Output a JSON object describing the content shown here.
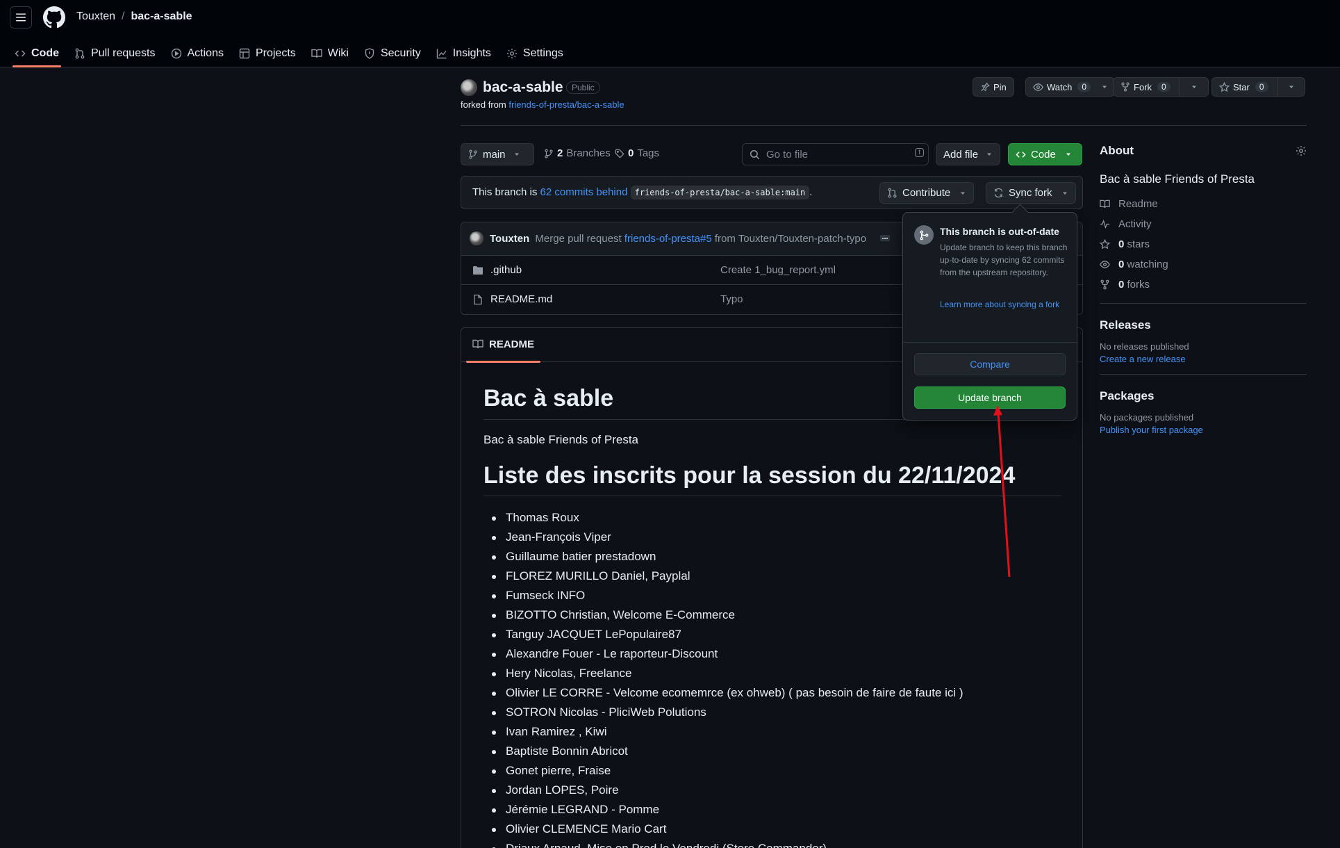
{
  "header": {
    "owner": "Touxten",
    "separator": "/",
    "repo": "bac-a-sable"
  },
  "tabs": [
    {
      "label": "Code",
      "icon": "code-icon"
    },
    {
      "label": "Pull requests",
      "icon": "pull-request-icon"
    },
    {
      "label": "Actions",
      "icon": "play-icon"
    },
    {
      "label": "Projects",
      "icon": "table-icon"
    },
    {
      "label": "Wiki",
      "icon": "book-icon"
    },
    {
      "label": "Security",
      "icon": "shield-icon"
    },
    {
      "label": "Insights",
      "icon": "graph-icon"
    },
    {
      "label": "Settings",
      "icon": "gear-icon"
    }
  ],
  "repo": {
    "name": "bac-a-sable",
    "visibility": "Public",
    "forked_prefix": "forked from",
    "forked_from": "friends-of-presta/bac-a-sable"
  },
  "actions": {
    "pin": "Pin",
    "watch": "Watch",
    "watch_count": "0",
    "fork": "Fork",
    "fork_count": "0",
    "star": "Star",
    "star_count": "0"
  },
  "toolbar": {
    "branch": "main",
    "branches_count": "2",
    "branches_label": "Branches",
    "tags_count": "0",
    "tags_label": "Tags",
    "search_placeholder": "Go to file",
    "search_kbd": "t",
    "add_file": "Add file",
    "code": "Code"
  },
  "branch_info": {
    "prefix": "This branch is",
    "behind": "62 commits behind",
    "upstream": "friends-of-presta/bac-a-sable:main",
    "suffix": ".",
    "contribute": "Contribute",
    "sync_fork": "Sync fork"
  },
  "commit": {
    "author": "Touxten",
    "message_prefix": "Merge pull request",
    "pr_link": "friends-of-presta#5",
    "message_suffix": "from Touxten/Touxten-patch-typo"
  },
  "files": [
    {
      "name": ".github",
      "type": "folder",
      "message": "Create 1_bug_report.yml"
    },
    {
      "name": "README.md",
      "type": "file",
      "message": "Typo"
    }
  ],
  "readme": {
    "tab": "README",
    "title": "Bac à sable",
    "description": "Bac à sable Friends of Presta",
    "session_title": "Liste des inscrits pour la session du 22/11/2024",
    "attendees": [
      "Thomas Roux",
      "Jean-François Viper",
      "Guillaume batier prestadown",
      "FLOREZ MURILLO Daniel, Payplal",
      "Fumseck INFO",
      "BIZOTTO Christian, Welcome E-Commerce",
      "Tanguy JACQUET LePopulaire87",
      "Alexandre Fouer - Le raporteur-Discount",
      "Hery Nicolas, Freelance",
      "Olivier LE CORRE - Velcome ecomemrce (ex ohweb) ( pas besoin de faire de faute ici )",
      "SOTRON Nicolas - PliciWeb Polutions",
      "Ivan Ramirez , Kiwi",
      "Baptiste Bonnin Abricot",
      "Gonet pierre, Fraise",
      "Jordan LOPES, Poire",
      "Jérémie LEGRAND - Pomme",
      "Olivier CLEMENCE Mario Cart",
      "Driaux Arnaud, Mise en Prod le Vendredi (Store Commander)"
    ]
  },
  "about": {
    "title": "About",
    "description": "Bac à sable Friends of Presta",
    "readme": "Readme",
    "activity": "Activity",
    "stars_count": "0",
    "stars_label": "stars",
    "watching_count": "0",
    "watching_label": "watching",
    "forks_count": "0",
    "forks_label": "forks",
    "releases_title": "Releases",
    "releases_none": "No releases published",
    "releases_link": "Create a new release",
    "packages_title": "Packages",
    "packages_none": "No packages published",
    "packages_link": "Publish your first package"
  },
  "popover": {
    "title": "This branch is out-of-date",
    "body": "Update branch to keep this branch up-to-date by syncing 62 commits from the upstream repository.",
    "link": "Learn more about syncing a fork",
    "compare": "Compare",
    "update": "Update branch"
  },
  "colors": {
    "accent": "#f78166",
    "link": "#4493f8",
    "green": "#238636",
    "arrow": "#e3101a"
  }
}
